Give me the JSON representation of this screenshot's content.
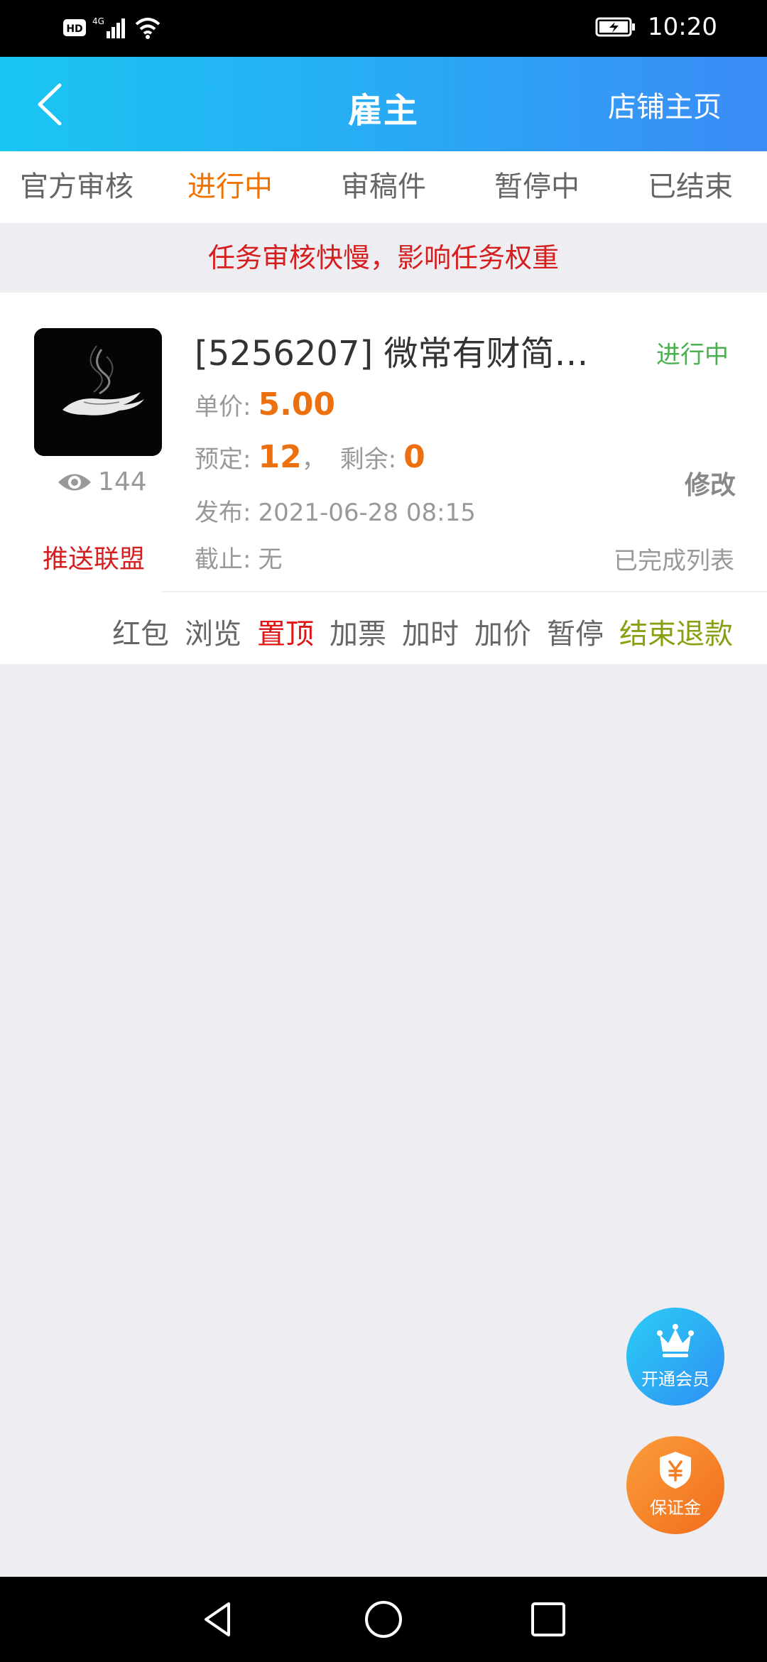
{
  "status_bar": {
    "network": "HD",
    "signal_label": "4G",
    "time": "10:20"
  },
  "header": {
    "title": "雇主",
    "shop_link": "店铺主页"
  },
  "tabs": [
    {
      "label": "官方审核",
      "active": false
    },
    {
      "label": "进行中",
      "active": true
    },
    {
      "label": "审稿件",
      "active": false
    },
    {
      "label": "暂停中",
      "active": false
    },
    {
      "label": "已结束",
      "active": false
    }
  ],
  "notice": "任务审核快慢，影响任务权重",
  "task": {
    "title": "[5256207] 微常有财简单…",
    "status": "进行中",
    "views": "144",
    "push_alliance": "推送联盟",
    "unit_price_label": "单价:",
    "unit_price": "5.00",
    "reserved_label": "预定:",
    "reserved": "12",
    "separator": "，",
    "remaining_label": "剩余:",
    "remaining": "0",
    "published_label": "发布:",
    "published": "2021-06-28 08:15",
    "deadline_label": "截止:",
    "deadline": "无",
    "edit": "修改",
    "completed_list": "已完成列表",
    "actions": [
      {
        "label": "红包",
        "style": "normal"
      },
      {
        "label": "浏览",
        "style": "normal"
      },
      {
        "label": "置顶",
        "style": "red"
      },
      {
        "label": "加票",
        "style": "normal"
      },
      {
        "label": "加时",
        "style": "normal"
      },
      {
        "label": "加价",
        "style": "normal"
      },
      {
        "label": "暂停",
        "style": "normal"
      },
      {
        "label": "结束退款",
        "style": "olive"
      }
    ]
  },
  "fab": {
    "member": "开通会员",
    "deposit": "保证金"
  },
  "colors": {
    "accent_orange": "#f07300",
    "alert_red": "#d51f1f",
    "status_green": "#4caf50",
    "header_gradient_start": "#19c6f2",
    "header_gradient_end": "#3b8bf6"
  }
}
